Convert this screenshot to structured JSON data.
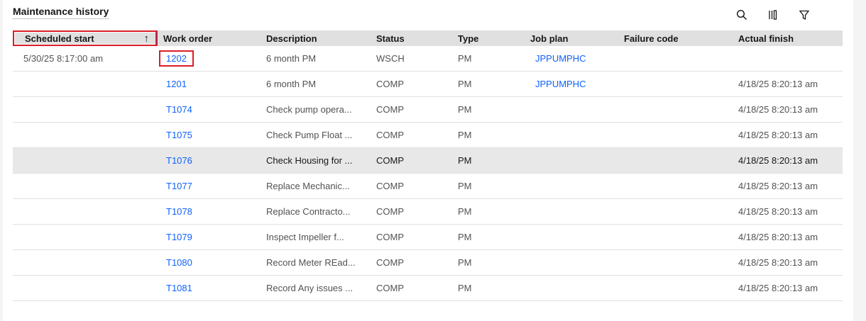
{
  "title": "Maintenance history",
  "toolbar": {
    "icons": [
      "search-icon",
      "columns-icon",
      "filter-icon"
    ]
  },
  "columns": [
    "Scheduled start",
    "Work order",
    "Description",
    "Status",
    "Type",
    "Job plan",
    "Failure code",
    "Actual finish"
  ],
  "sort_arrow": "↑",
  "rows": [
    {
      "scheduled_start": "5/30/25 8:17:00 am",
      "work_order": "1202",
      "description": "6 month PM",
      "status": "WSCH",
      "type": "PM",
      "job_plan": "JPPUMPHC",
      "failure_code": "",
      "actual_finish": ""
    },
    {
      "scheduled_start": "",
      "work_order": "1201",
      "description": "6 month PM",
      "status": "COMP",
      "type": "PM",
      "job_plan": "JPPUMPHC",
      "failure_code": "",
      "actual_finish": "4/18/25 8:20:13 am"
    },
    {
      "scheduled_start": "",
      "work_order": "T1074",
      "description": "Check pump opera...",
      "status": "COMP",
      "type": "PM",
      "job_plan": "",
      "failure_code": "",
      "actual_finish": "4/18/25 8:20:13 am"
    },
    {
      "scheduled_start": "",
      "work_order": "T1075",
      "description": "Check Pump Float ...",
      "status": "COMP",
      "type": "PM",
      "job_plan": "",
      "failure_code": "",
      "actual_finish": "4/18/25 8:20:13 am"
    },
    {
      "scheduled_start": "",
      "work_order": "T1076",
      "description": "Check Housing for ...",
      "status": "COMP",
      "type": "PM",
      "job_plan": "",
      "failure_code": "",
      "actual_finish": "4/18/25 8:20:13 am"
    },
    {
      "scheduled_start": "",
      "work_order": "T1077",
      "description": "Replace Mechanic...",
      "status": "COMP",
      "type": "PM",
      "job_plan": "",
      "failure_code": "",
      "actual_finish": "4/18/25 8:20:13 am"
    },
    {
      "scheduled_start": "",
      "work_order": "T1078",
      "description": "Replace Contracto...",
      "status": "COMP",
      "type": "PM",
      "job_plan": "",
      "failure_code": "",
      "actual_finish": "4/18/25 8:20:13 am"
    },
    {
      "scheduled_start": "",
      "work_order": "T1079",
      "description": "Inspect Impeller f...",
      "status": "COMP",
      "type": "PM",
      "job_plan": "",
      "failure_code": "",
      "actual_finish": "4/18/25 8:20:13 am"
    },
    {
      "scheduled_start": "",
      "work_order": "T1080",
      "description": "Record Meter REad...",
      "status": "COMP",
      "type": "PM",
      "job_plan": "",
      "failure_code": "",
      "actual_finish": "4/18/25 8:20:13 am"
    },
    {
      "scheduled_start": "",
      "work_order": "T1081",
      "description": "Record Any issues ...",
      "status": "COMP",
      "type": "PM",
      "job_plan": "",
      "failure_code": "",
      "actual_finish": "4/18/25 8:20:13 am"
    }
  ],
  "colors": {
    "link": "#0f62fe",
    "highlight": "#da1e28",
    "header_bg": "#e0e0e0"
  }
}
